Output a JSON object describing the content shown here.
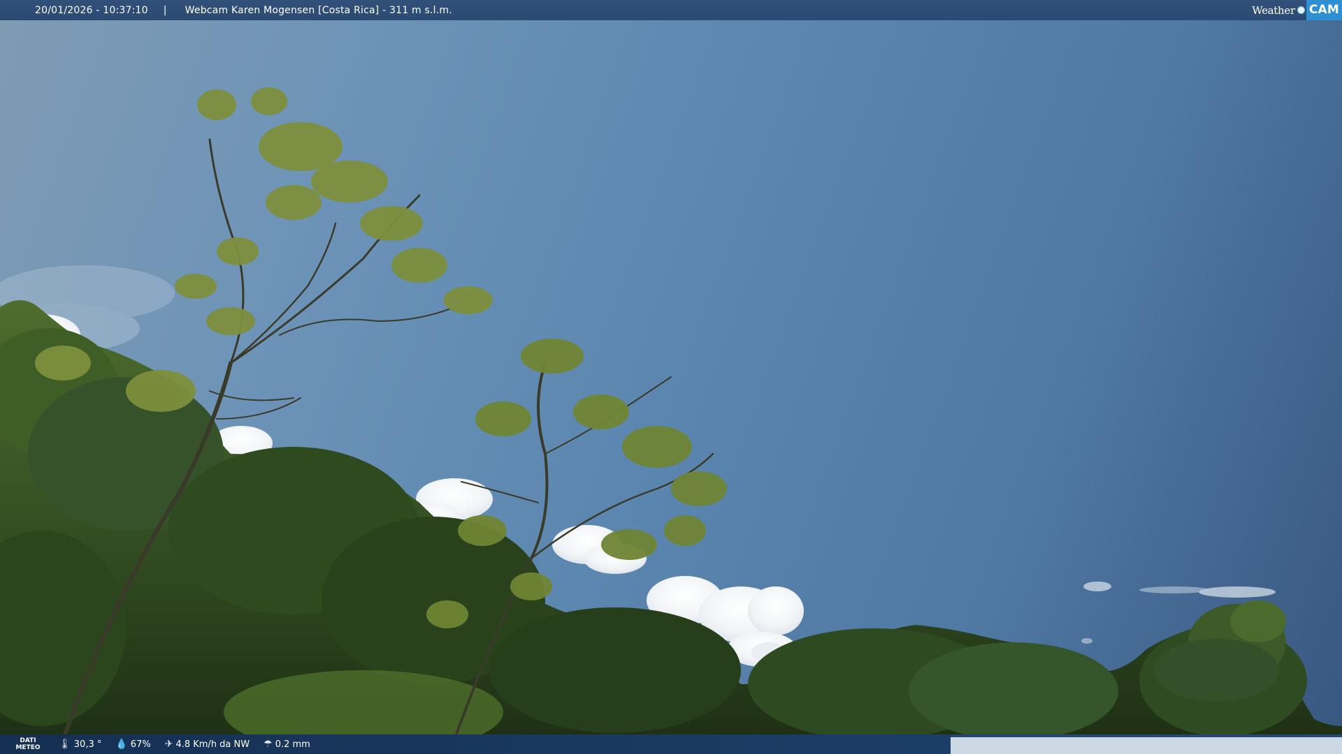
{
  "header": {
    "timestamp": "20/01/2026 - 10:37:10",
    "separator": "|",
    "title": "Webcam Karen Mogensen [Costa Rica] - 311 m s.l.m."
  },
  "brand": {
    "word": "Weather",
    "cam": "CAM"
  },
  "weather": {
    "label_line1": "DATI",
    "label_line2": "METEO",
    "temperature": "30,3 °",
    "humidity": "67%",
    "wind": "4.8 Km/h da NW",
    "rain": "0.2 mm"
  },
  "icons": {
    "temperature": "thermometer-icon",
    "humidity": "droplet-icon",
    "wind": "wind-icon",
    "rain": "rain-icon"
  },
  "colors": {
    "topbar": "#2b4a72",
    "bottombar": "#254772",
    "brand_accent": "#2e8fd3"
  }
}
